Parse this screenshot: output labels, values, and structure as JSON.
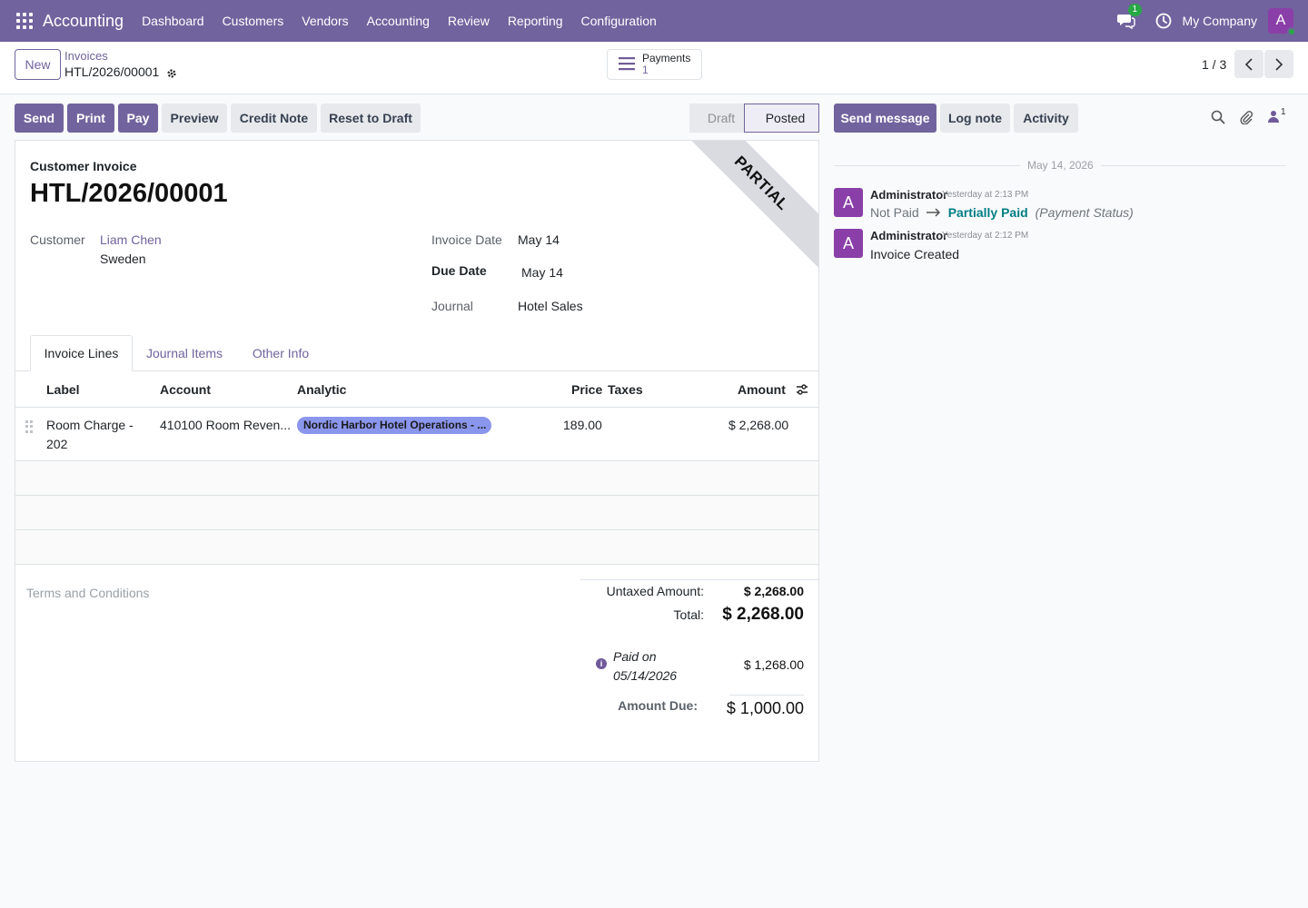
{
  "navbar": {
    "app_name": "Accounting",
    "menu": [
      "Dashboard",
      "Customers",
      "Vendors",
      "Accounting",
      "Review",
      "Reporting",
      "Configuration"
    ],
    "messages_count": "1",
    "company": "My Company",
    "avatar_letter": "A",
    "bg_color": "#71639e"
  },
  "control": {
    "new_label": "New",
    "breadcrumb_parent": "Invoices",
    "breadcrumb_current": "HTL/2026/00001",
    "smart_button": {
      "label": "Payments",
      "value": "1"
    },
    "pager": "1 / 3"
  },
  "actions": {
    "send": "Send",
    "print": "Print",
    "pay": "Pay",
    "preview": "Preview",
    "credit_note": "Credit Note",
    "reset_to_draft": "Reset to Draft"
  },
  "status": {
    "stages": [
      "Draft",
      "Posted"
    ],
    "current": "Posted"
  },
  "form": {
    "ribbon": "PARTIAL",
    "doc_type": "Customer Invoice",
    "doc_name": "HTL/2026/00001",
    "customer_label": "Customer",
    "customer_name": "Liam Chen",
    "customer_country": "Sweden",
    "invoice_date_label": "Invoice Date",
    "invoice_date": "May 14",
    "due_date_label": "Due Date",
    "due_date": "May 14",
    "journal_label": "Journal",
    "journal": "Hotel Sales"
  },
  "tabs": [
    "Invoice Lines",
    "Journal Items",
    "Other Info"
  ],
  "table": {
    "headers": {
      "label": "Label",
      "account": "Account",
      "analytic": "Analytic",
      "price": "Price",
      "taxes": "Taxes",
      "amount": "Amount"
    },
    "rows": [
      {
        "label": "Room Charge - 202",
        "account": "410100 Room Reven...",
        "analytic": "Nordic Harbor Hotel Operations - ...",
        "price": "189.00",
        "taxes": "",
        "amount": "$ 2,268.00"
      }
    ]
  },
  "totals": {
    "terms_placeholder": "Terms and Conditions",
    "untaxed_label": "Untaxed Amount:",
    "untaxed_value": "$ 2,268.00",
    "total_label": "Total:",
    "total_value": "$ 2,268.00",
    "paid_on_label": "Paid on",
    "paid_on_date": "05/14/2026",
    "paid_amount": "$ 1,268.00",
    "amount_due_label": "Amount Due:",
    "amount_due_value": "$ 1,000.00"
  },
  "chatter": {
    "send_message": "Send message",
    "log_note": "Log note",
    "activity": "Activity",
    "followers_count": "1",
    "date_separator": "May 14, 2026",
    "messages": [
      {
        "author": "Administrator",
        "time": "Yesterday at 2:13 PM",
        "avatar": "A",
        "old_value": "Not Paid",
        "new_value": "Partially Paid",
        "field": "(Payment Status)"
      },
      {
        "author": "Administrator",
        "time": "Yesterday at 2:12 PM",
        "avatar": "A",
        "body": "Invoice Created"
      }
    ]
  }
}
